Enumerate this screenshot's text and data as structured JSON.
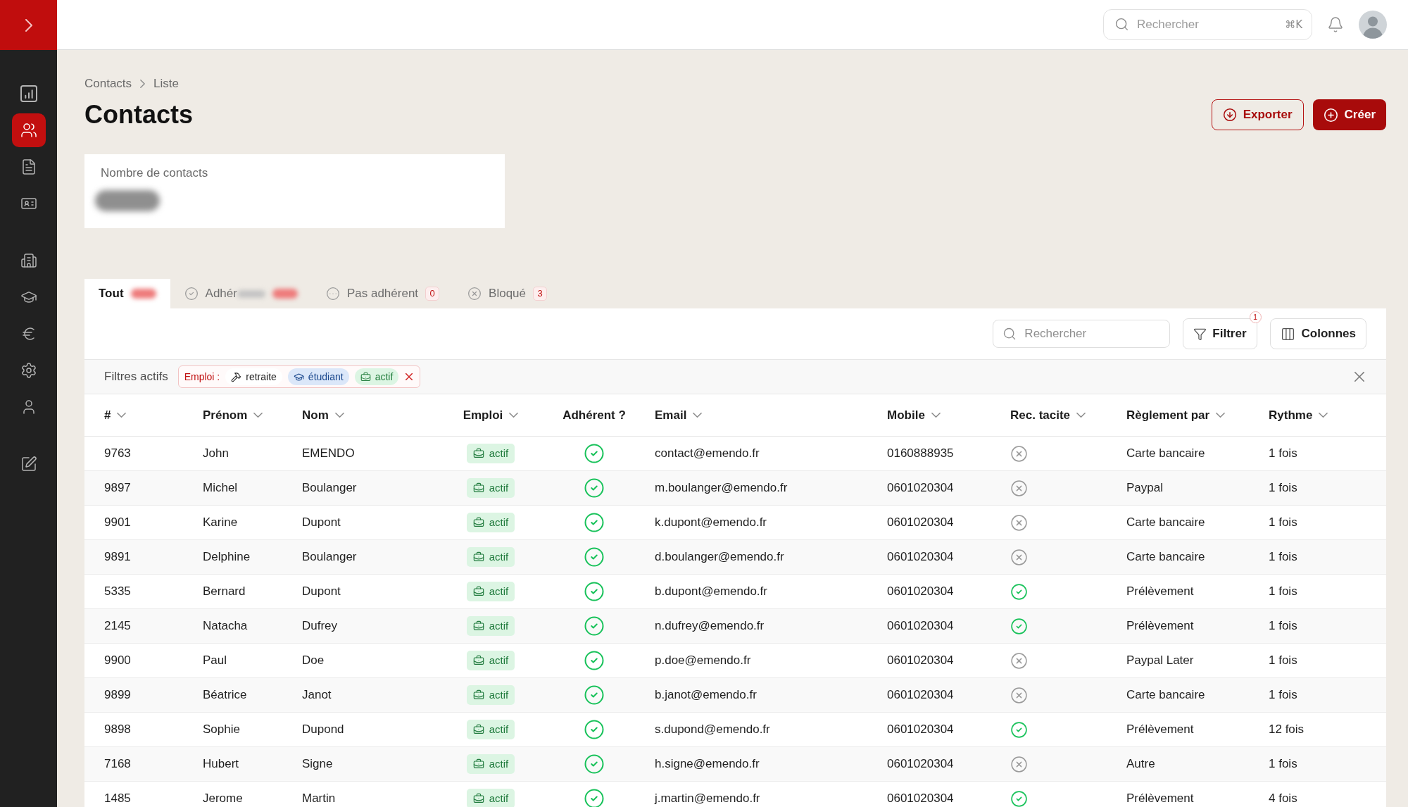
{
  "sidebar": {
    "groups": [
      {
        "items": [
          {
            "selected": false
          },
          {
            "selected": true
          },
          {
            "selected": false
          },
          {
            "selected": false
          }
        ]
      },
      {
        "items": [
          {
            "selected": false
          },
          {
            "selected": false
          },
          {
            "selected": false
          },
          {
            "selected": false
          },
          {
            "selected": false
          }
        ]
      },
      {
        "items": [
          {
            "selected": false
          }
        ]
      }
    ]
  },
  "top_bar": {
    "search": {
      "placeholder": "Rechercher",
      "shortcut": "⌘K"
    }
  },
  "breadcrumb": [
    {
      "label": "Contacts"
    },
    {
      "label": "Liste"
    }
  ],
  "page_title": "Contacts",
  "actions": [
    {
      "label": "Exporter",
      "kind": "outline"
    },
    {
      "label": "Créer",
      "kind": "primary"
    }
  ],
  "stat_card": {
    "label": "Nombre de contacts",
    "redacted": true
  },
  "tabs": [
    {
      "label": "Tout",
      "selected": true,
      "redacted_text": false,
      "redacted_badge": true
    },
    {
      "label": "Adhér",
      "selected": false,
      "redacted_text": true,
      "redacted_badge": true
    },
    {
      "label": "Pas adhérent",
      "selected": false,
      "redacted_text": false,
      "redacted_badge": false,
      "count": "0"
    },
    {
      "label": "Bloqué",
      "selected": false,
      "redacted_text": false,
      "redacted_badge": false,
      "count": "3"
    }
  ],
  "toolbar": {
    "search": {
      "placeholder": "Rechercher"
    },
    "filter": {
      "label": "Filtrer",
      "badge": "1"
    },
    "columns": {
      "label": "Colonnes"
    }
  },
  "active_filters": {
    "label": "Filtres actifs",
    "field": "Emploi :",
    "values": [
      {
        "label": "retraite",
        "color": "#ffffff"
      },
      {
        "label": "étudiant",
        "color": "#dbe7f9"
      },
      {
        "label": "actif",
        "color": "#dcf5e3"
      }
    ]
  },
  "table": {
    "columns": [
      {
        "label": "#",
        "sortable": true
      },
      {
        "label": "Prénom",
        "sortable": true
      },
      {
        "label": "Nom",
        "sortable": true
      },
      {
        "label": "Emploi",
        "sortable": true
      },
      {
        "label": "Adhérent ?",
        "sortable": false
      },
      {
        "label": "Email",
        "sortable": true
      },
      {
        "label": "Mobile",
        "sortable": true
      },
      {
        "label": "Rec. tacite",
        "sortable": true
      },
      {
        "label": "Règlement par",
        "sortable": true
      },
      {
        "label": "Rythme",
        "sortable": true
      }
    ],
    "rows": [
      {
        "id": "9763",
        "first_name": "John",
        "last_name": "EMENDO",
        "job": "actif",
        "member": true,
        "email": "contact@emendo.fr",
        "mobile": "0160888935",
        "tacit_renewal": false,
        "payment": "Carte bancaire",
        "rhythm": "1 fois"
      },
      {
        "id": "9897",
        "first_name": "Michel",
        "last_name": "Boulanger",
        "job": "actif",
        "member": true,
        "email": "m.boulanger@emendo.fr",
        "mobile": "0601020304",
        "tacit_renewal": false,
        "payment": "Paypal",
        "rhythm": "1 fois"
      },
      {
        "id": "9901",
        "first_name": "Karine",
        "last_name": "Dupont",
        "job": "actif",
        "member": true,
        "email": "k.dupont@emendo.fr",
        "mobile": "0601020304",
        "tacit_renewal": false,
        "payment": "Carte bancaire",
        "rhythm": "1 fois"
      },
      {
        "id": "9891",
        "first_name": "Delphine",
        "last_name": "Boulanger",
        "job": "actif",
        "member": true,
        "email": "d.boulanger@emendo.fr",
        "mobile": "0601020304",
        "tacit_renewal": false,
        "payment": "Carte bancaire",
        "rhythm": "1 fois"
      },
      {
        "id": "5335",
        "first_name": "Bernard",
        "last_name": "Dupont",
        "job": "actif",
        "member": true,
        "email": "b.dupont@emendo.fr",
        "mobile": "0601020304",
        "tacit_renewal": true,
        "payment": "Prélèvement",
        "rhythm": "1 fois"
      },
      {
        "id": "2145",
        "first_name": "Natacha",
        "last_name": "Dufrey",
        "job": "actif",
        "member": true,
        "email": "n.dufrey@emendo.fr",
        "mobile": "0601020304",
        "tacit_renewal": true,
        "payment": "Prélèvement",
        "rhythm": "1 fois"
      },
      {
        "id": "9900",
        "first_name": "Paul",
        "last_name": "Doe",
        "job": "actif",
        "member": true,
        "email": "p.doe@emendo.fr",
        "mobile": "0601020304",
        "tacit_renewal": false,
        "payment": "Paypal Later",
        "rhythm": "1 fois"
      },
      {
        "id": "9899",
        "first_name": "Béatrice",
        "last_name": "Janot",
        "job": "actif",
        "member": true,
        "email": "b.janot@emendo.fr",
        "mobile": "0601020304",
        "tacit_renewal": false,
        "payment": "Carte bancaire",
        "rhythm": "1 fois"
      },
      {
        "id": "9898",
        "first_name": "Sophie",
        "last_name": "Dupond",
        "job": "actif",
        "member": true,
        "email": "s.dupond@emendo.fr",
        "mobile": "0601020304",
        "tacit_renewal": true,
        "payment": "Prélèvement",
        "rhythm": "12 fois"
      },
      {
        "id": "7168",
        "first_name": "Hubert",
        "last_name": "Signe",
        "job": "actif",
        "member": true,
        "email": "h.signe@emendo.fr",
        "mobile": "0601020304",
        "tacit_renewal": false,
        "payment": "Autre",
        "rhythm": "1 fois"
      },
      {
        "id": "1485",
        "first_name": "Jerome",
        "last_name": "Martin",
        "job": "actif",
        "member": true,
        "email": "j.martin@emendo.fr",
        "mobile": "0601020304",
        "tacit_renewal": true,
        "payment": "Prélèvement",
        "rhythm": "4 fois"
      }
    ]
  }
}
